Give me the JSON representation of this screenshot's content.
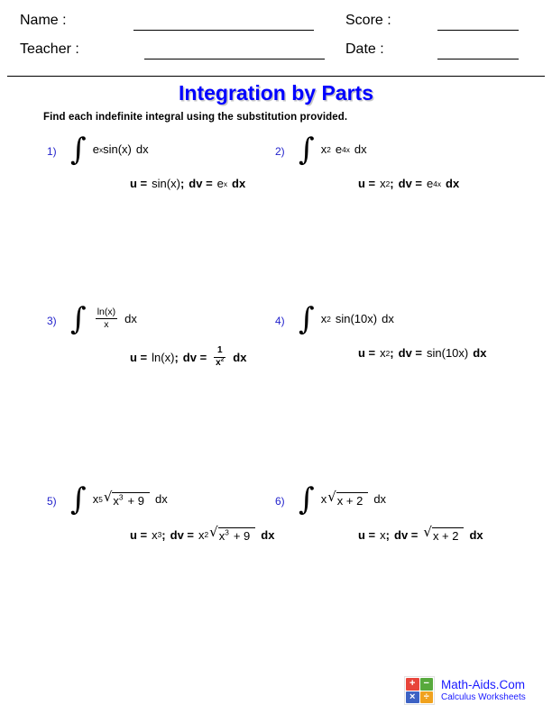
{
  "header": {
    "name_label": "Name :",
    "teacher_label": "Teacher :",
    "score_label": "Score :",
    "date_label": "Date :",
    "name_value": "",
    "teacher_value": "",
    "score_value": "",
    "date_value": ""
  },
  "title": "Integration by Parts",
  "instructions": "Find each indefinite integral using the substitution provided.",
  "title_color": "#0000FF",
  "number_color": "#2222CC",
  "problems": [
    {
      "number": "1)",
      "integral_text": "∫ e^x sin(x) dx",
      "substitution_text": "u = sin(x); dv = e^x dx",
      "parts": {
        "base1": "e",
        "exp1": "x",
        "fn": "sin(x)",
        "dx": "dx"
      },
      "sub_parts": {
        "u_label": "u =",
        "u_value": "sin(x)",
        "semicolon": ";",
        "dv_label": "dv =",
        "dv_base": "e",
        "dv_exp": "x",
        "dx": "dx"
      }
    },
    {
      "number": "2)",
      "integral_text": "∫ x^2 e^4x dx",
      "substitution_text": "u = x^2; dv = e^4x dx",
      "parts": {
        "base1": "x",
        "exp1": "2",
        "base2": "e",
        "exp2": "4x",
        "dx": "dx"
      },
      "sub_parts": {
        "u_label": "u =",
        "u_base": "x",
        "u_exp": "2",
        "semicolon": ";",
        "dv_label": "dv =",
        "dv_base": "e",
        "dv_exp": "4x",
        "dx": "dx"
      }
    },
    {
      "number": "3)",
      "integral_text": "∫ ln(x)/x dx",
      "substitution_text": "u = ln(x); dv = 1/x^2 dx",
      "parts": {
        "frac_num": "ln(x)",
        "frac_den": "x",
        "dx": "dx"
      },
      "sub_parts": {
        "u_label": "u =",
        "u_value": "ln(x)",
        "semicolon": ";",
        "dv_label": "dv =",
        "dv_frac_num": "1",
        "dv_frac_den_base": "x",
        "dv_frac_den_exp": "2",
        "dx": "dx"
      }
    },
    {
      "number": "4)",
      "integral_text": "∫ x^2 sin(10x) dx",
      "substitution_text": "u = x^2; dv = sin(10x) dx",
      "parts": {
        "base1": "x",
        "exp1": "2",
        "fn": "sin(10x)",
        "dx": "dx"
      },
      "sub_parts": {
        "u_label": "u =",
        "u_base": "x",
        "u_exp": "2",
        "semicolon": ";",
        "dv_label": "dv =",
        "dv_value": "sin(10x)",
        "dx": "dx"
      }
    },
    {
      "number": "5)",
      "integral_text": "∫ x^5 √(x^3 + 9) dx",
      "substitution_text": "u = x^3; dv = x^2 √(x^3 + 9) dx",
      "parts": {
        "base1": "x",
        "exp1": "5",
        "surd": "√",
        "rad_base": "x",
        "rad_exp": "3",
        "rad_rest": "+ 9",
        "dx": "dx"
      },
      "sub_parts": {
        "u_label": "u =",
        "u_base": "x",
        "u_exp": "3",
        "semicolon": ";",
        "dv_label": "dv =",
        "dv_base": "x",
        "dv_exp": "2",
        "surd": "√",
        "rad_base": "x",
        "rad_exp": "3",
        "rad_rest": "+ 9",
        "dx": "dx"
      }
    },
    {
      "number": "6)",
      "integral_text": "∫ x√(x + 2) dx",
      "substitution_text": "u = x; dv = √(x + 2) dx",
      "parts": {
        "base1": "x",
        "surd": "√",
        "rad_rest": "x + 2",
        "dx": "dx"
      },
      "sub_parts": {
        "u_label": "u =",
        "u_value": "x",
        "semicolon": ";",
        "dv_label": "dv =",
        "surd": "√",
        "rad_rest": "x + 2",
        "dx": "dx"
      }
    }
  ],
  "integral_symbol": "∫",
  "footer": {
    "site": "Math-Aids.Com",
    "subject": "Calculus Worksheets",
    "tiles": [
      {
        "name": "plus-tile",
        "glyph": "+",
        "color": "#E8443A"
      },
      {
        "name": "minus-tile",
        "glyph": "−",
        "color": "#57A93C"
      },
      {
        "name": "times-tile",
        "glyph": "×",
        "color": "#3D62C4"
      },
      {
        "name": "divide-tile",
        "glyph": "÷",
        "color": "#F0A21E"
      }
    ]
  }
}
